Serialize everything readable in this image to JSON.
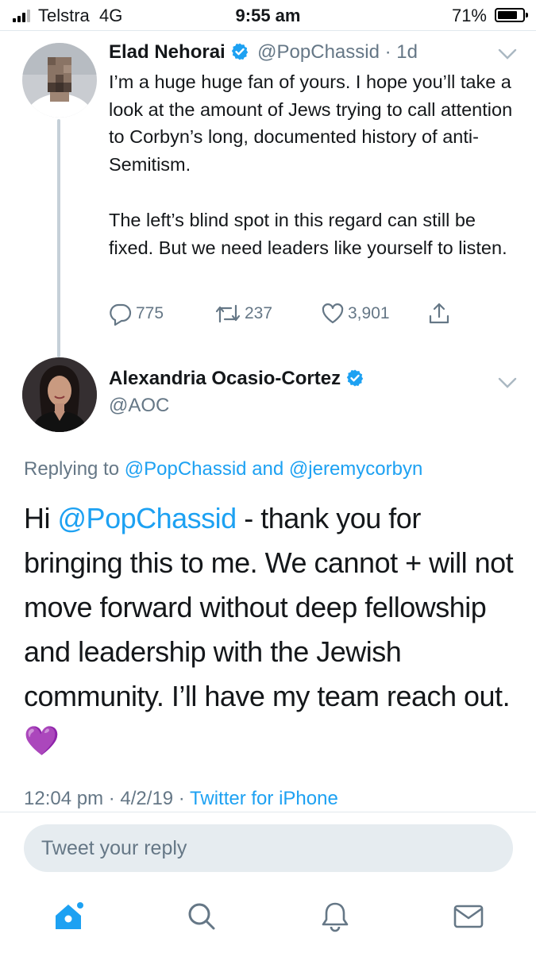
{
  "status_bar": {
    "carrier": "Telstra",
    "network": "4G",
    "time": "9:55 am",
    "battery": "71%",
    "battery_level": 0.71
  },
  "original_tweet": {
    "author_name": "Elad Nehorai",
    "handle": "@PopChassid",
    "age": "1d",
    "body": [
      "I’m a huge huge fan of yours. I hope you’ll take a look at the amount of Jews trying to call attention to Corbyn’s long, documented history of anti-Semitism.",
      "The left’s blind spot in this regard can still be fixed. But we need leaders like yourself to listen."
    ],
    "replies": "775",
    "retweets": "237",
    "likes": "3,901",
    "icons": [
      "reply-icon",
      "retweet-icon",
      "like-icon",
      "share-icon",
      "verified-icon",
      "chevron-down-icon"
    ]
  },
  "main_tweet": {
    "author_name": "Alexandria Ocasio-Cortez",
    "handle": "@AOC",
    "replying_prefix": "Replying to",
    "replying_user1": "@PopChassid",
    "replying_and": "and",
    "replying_user2": "@jeremycorbyn",
    "body_greeting": "Hi",
    "body_mention": "@PopChassid",
    "body_text": "- thank you for bringing this to me. We cannot + will not move forward without deep fellowship and leadership with the Jewish community. I’ll have my team reach out.",
    "body_emoji": "💜",
    "timestamp": "12:04 pm",
    "date": "4/2/19",
    "source": "Twitter for iPhone"
  },
  "reply_box": {
    "placeholder": "Tweet your reply"
  },
  "tab_bar": {
    "items": [
      "home-icon",
      "search-icon",
      "notifications-icon",
      "messages-icon"
    ]
  },
  "colors": {
    "accent": "#1da1f2",
    "secondary_text": "#657786",
    "primary_text": "#14171a",
    "reply_box_bg": "#e6ecf0",
    "thread_line": "#c5d0d8",
    "heart_emoji": "#a24ee8"
  }
}
